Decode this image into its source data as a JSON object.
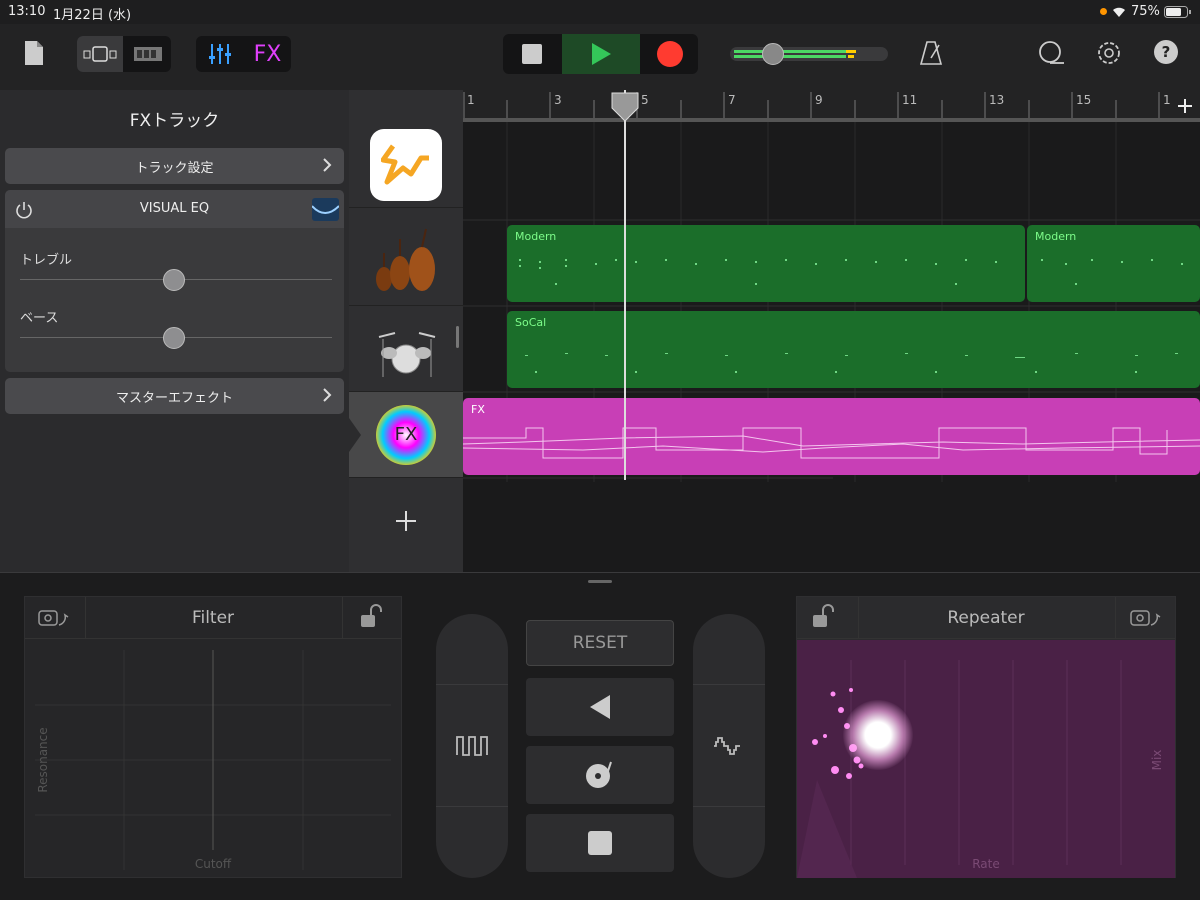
{
  "status": {
    "time": "13:10",
    "date": "1月22日 (水)",
    "battery": "75%"
  },
  "toolbar": {
    "fx_label": "FX",
    "icons": [
      "document-icon",
      "tracks-view-icon",
      "live-loops-icon",
      "mixer-icon",
      "stop-icon",
      "play-icon",
      "record-icon",
      "metronome-icon",
      "loop-icon",
      "settings-icon",
      "help-icon"
    ],
    "accent": "#e040fb"
  },
  "left_panel": {
    "title": "FXトラック",
    "track_settings": "トラック設定",
    "eq": {
      "title": "VISUAL EQ",
      "treble": "トレブル",
      "bass": "ベース"
    },
    "master_fx": "マスターエフェクト"
  },
  "ruler": {
    "marks": [
      "1",
      "3",
      "5",
      "7",
      "9",
      "11",
      "13",
      "15",
      "1"
    ]
  },
  "tracks": [
    {
      "name": "live-loops-track",
      "regions": []
    },
    {
      "name": "strings-track",
      "regions": [
        {
          "label": "Modern"
        },
        {
          "label": "Modern"
        }
      ]
    },
    {
      "name": "drums-track",
      "regions": [
        {
          "label": "SoCal"
        }
      ]
    },
    {
      "name": "fx-track",
      "icon_text": "FX",
      "regions": [
        {
          "label": "FX"
        }
      ]
    }
  ],
  "fx_pads": {
    "filter": {
      "title": "Filter",
      "xlabel": "Cutoff",
      "ylabel": "Resonance"
    },
    "center": {
      "reset": "RESET"
    },
    "repeater": {
      "title": "Repeater",
      "xlabel": "Rate",
      "ylabel": "Mix"
    }
  },
  "colors": {
    "region_green": "#1b6e2a",
    "fx_region": "#c83fb6",
    "play": "#34c759",
    "record": "#ff3b30",
    "repeater_bg": "#4a2146"
  }
}
